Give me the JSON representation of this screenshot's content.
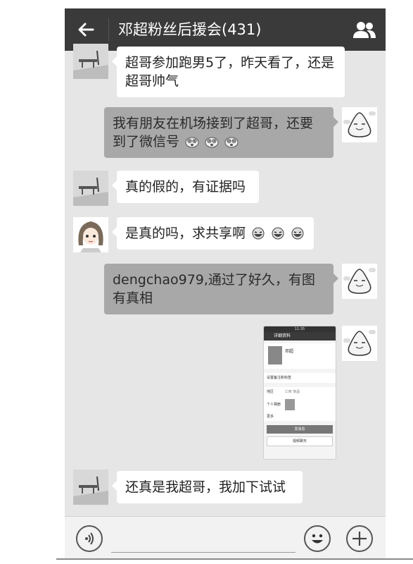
{
  "header": {
    "title": "邓超粉丝后援会(431)",
    "back_icon": "back-arrow-icon",
    "group_icon": "group-members-icon",
    "background": "#3a3a3a"
  },
  "messages": [
    {
      "side": "left",
      "avatar": "landscape-avatar",
      "text": "超哥参加跑男5了，昨天看了，还是超哥帅气"
    },
    {
      "side": "right",
      "avatar": "onigiri-avatar",
      "text": "我有朋友在机场接到了超哥，还要到了微信号",
      "emoji": "shocked-face-emoji ×3"
    },
    {
      "side": "left",
      "avatar": "landscape-avatar",
      "text": "真的假的，有证据吗"
    },
    {
      "side": "left",
      "avatar": "anime-girl-avatar",
      "text": "是真的吗，求共享啊",
      "emoji": "laughing-face-emoji ×3"
    },
    {
      "side": "right",
      "avatar": "onigiri-avatar",
      "text": "dengchao979,通过了好久，有图有真相"
    },
    {
      "side": "right",
      "avatar": "onigiri-avatar",
      "type": "image"
    },
    {
      "side": "left",
      "avatar": "landscape-avatar",
      "text": "还真是我超哥，我加下试试"
    }
  ],
  "screenshot": {
    "status": "11:35",
    "header": "详细资料",
    "name": "邓超",
    "alias_row": "设置备注和标签",
    "region_label": "地区",
    "region_value": "江西 南昌",
    "album_label": "个人相册",
    "more_label": "更多",
    "send_button": "发消息",
    "video_button": "视频聊天"
  },
  "composer": {
    "voice_icon": "voice-icon",
    "emoji_icon": "emoji-icon",
    "add_icon": "add-icon"
  }
}
